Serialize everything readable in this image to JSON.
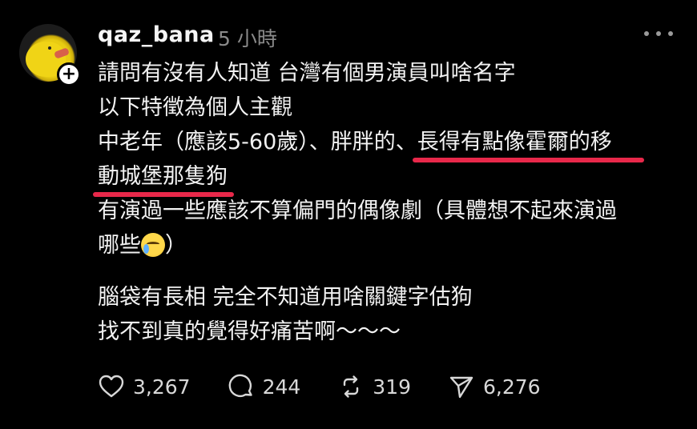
{
  "post": {
    "username": "qaz_bana",
    "timestamp": "5 小時",
    "lines": [
      "請問有沒有人知道 台灣有個男演員叫啥名字",
      "以下特徵為個人主觀",
      "中老年（應該5-60歲）、胖胖的、",
      "長得有點像霍爾的移",
      "動城堡那隻狗",
      "有演過一些應該不算偏門的偶像劇（具體想不起來演過",
      "哪些",
      "）",
      "腦袋有長相 完全不知道用啥關鍵字估狗",
      "找不到真的覺得好痛苦啊～～～"
    ],
    "emoji": "crying-face"
  },
  "actions": {
    "likes": "3,267",
    "comments": "244",
    "reposts": "319",
    "shares": "6,276"
  },
  "colors": {
    "background": "#000000",
    "text": "#f2f2f2",
    "muted": "#8a8a8a",
    "highlight_underline": "#e8284a"
  }
}
